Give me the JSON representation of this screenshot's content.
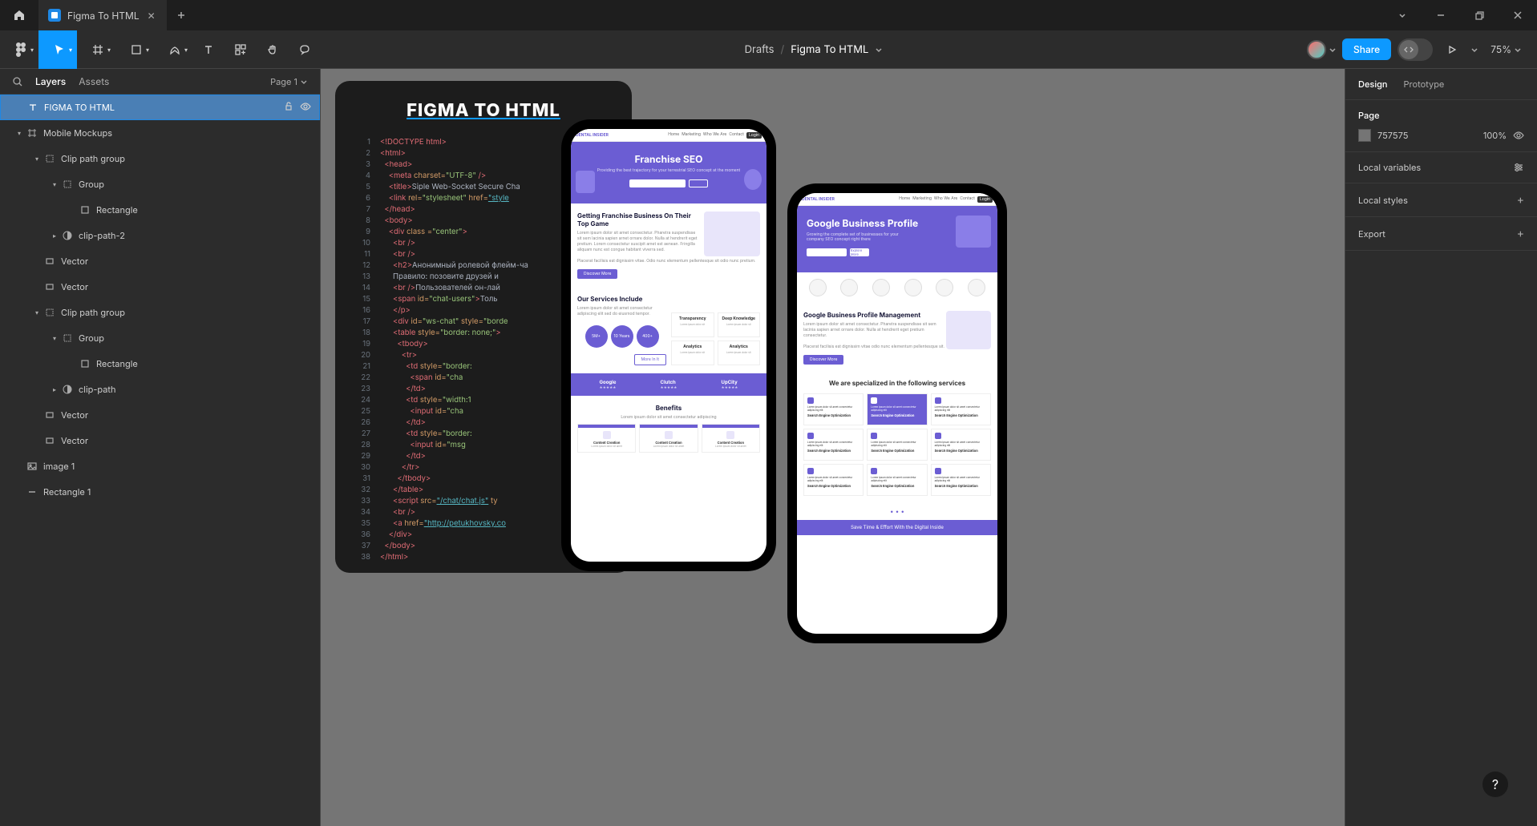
{
  "titlebar": {
    "tab_name": "Figma To HTML"
  },
  "toolbar": {
    "breadcrumb_root": "Drafts",
    "breadcrumb_current": "Figma To HTML",
    "share_label": "Share",
    "zoom_label": "75%"
  },
  "left_panel": {
    "tab_layers": "Layers",
    "tab_assets": "Assets",
    "page_label": "Page 1",
    "layers": [
      {
        "name": "FIGMA TO HTML",
        "type": "text",
        "depth": 0,
        "selected": true,
        "actions": true
      },
      {
        "name": "Mobile Mockups",
        "type": "frame",
        "depth": 0,
        "expanded": true
      },
      {
        "name": "Clip path group",
        "type": "group",
        "depth": 1,
        "expanded": true
      },
      {
        "name": "Group",
        "type": "group",
        "depth": 2,
        "expanded": true
      },
      {
        "name": "Rectangle",
        "type": "rect",
        "depth": 3
      },
      {
        "name": "clip-path-2",
        "type": "mask",
        "depth": 2,
        "collapsed": true
      },
      {
        "name": "Vector",
        "type": "vector",
        "depth": 1
      },
      {
        "name": "Vector",
        "type": "vector",
        "depth": 1
      },
      {
        "name": "Clip path group",
        "type": "group",
        "depth": 1,
        "expanded": true
      },
      {
        "name": "Group",
        "type": "group",
        "depth": 2,
        "expanded": true
      },
      {
        "name": "Rectangle",
        "type": "rect",
        "depth": 3
      },
      {
        "name": "clip-path",
        "type": "mask",
        "depth": 2,
        "collapsed": true
      },
      {
        "name": "Vector",
        "type": "vector",
        "depth": 1
      },
      {
        "name": "Vector",
        "type": "vector",
        "depth": 1
      },
      {
        "name": "image 1",
        "type": "image",
        "depth": 0
      },
      {
        "name": "Rectangle 1",
        "type": "line",
        "depth": 0
      }
    ]
  },
  "right_panel": {
    "tab_design": "Design",
    "tab_prototype": "Prototype",
    "page_section": "Page",
    "page_color": "757575",
    "page_opacity": "100%",
    "local_variables": "Local variables",
    "local_styles": "Local styles",
    "export": "Export"
  },
  "canvas": {
    "code_title": "FIGMA TO HTML",
    "code_lines": [
      {
        "n": 1,
        "html": "<span class='c-tag'>&lt;!DOCTYPE html&gt;</span>"
      },
      {
        "n": 2,
        "html": "<span class='c-tag'>&lt;html&gt;</span>"
      },
      {
        "n": 3,
        "html": "  <span class='c-tag'>&lt;head&gt;</span>"
      },
      {
        "n": 4,
        "html": "    <span class='c-tag'>&lt;meta</span> <span class='c-attr'>charset=</span><span class='c-str'>\"UTF-8\"</span> <span class='c-tag'>/&gt;</span>"
      },
      {
        "n": 5,
        "html": "    <span class='c-tag'>&lt;title&gt;</span><span class='c-text'>Siple Web-Socket Secure Cha</span>"
      },
      {
        "n": 6,
        "html": "    <span class='c-tag'>&lt;link</span> <span class='c-attr'>rel=</span><span class='c-str'>\"stylesheet\"</span> <span class='c-attr'>href=</span><span class='c-link'>\"style</span>"
      },
      {
        "n": 7,
        "html": "  <span class='c-tag'>&lt;/head&gt;</span>"
      },
      {
        "n": 8,
        "html": "  <span class='c-tag'>&lt;body&gt;</span>"
      },
      {
        "n": 9,
        "html": "    <span class='c-tag'>&lt;div</span> <span class='c-attr'>class =</span><span class='c-str'>\"center\"</span><span class='c-tag'>&gt;</span>"
      },
      {
        "n": 10,
        "html": "      <span class='c-tag'>&lt;br /&gt;</span>"
      },
      {
        "n": 11,
        "html": "      <span class='c-tag'>&lt;br /&gt;</span>"
      },
      {
        "n": 12,
        "html": "      <span class='c-tag'>&lt;h2&gt;</span><span class='c-text'>Анонимный ролевой флейм-ча</span>"
      },
      {
        "n": 13,
        "html": "      <span class='c-text'>Правило: позовите друзей и </span>"
      },
      {
        "n": 14,
        "html": "      <span class='c-tag'>&lt;br /&gt;</span><span class='c-text'>Пользователей он-лай</span>"
      },
      {
        "n": 15,
        "html": "      <span class='c-tag'>&lt;span</span> <span class='c-attr'>id=</span><span class='c-str'>\"chat-users\"</span><span class='c-tag'>&gt;</span><span class='c-text'>Толь</span>"
      },
      {
        "n": 16,
        "html": "      <span class='c-tag'>&lt;/p&gt;</span>"
      },
      {
        "n": 17,
        "html": "      <span class='c-tag'>&lt;div</span> <span class='c-attr'>id=</span><span class='c-str'>\"ws-chat\"</span> <span class='c-attr'>style=</span><span class='c-str'>\"borde</span>"
      },
      {
        "n": 18,
        "html": "      <span class='c-tag'>&lt;table</span> <span class='c-attr'>style=</span><span class='c-str'>\"border: none;\"</span><span class='c-tag'>&gt;</span>"
      },
      {
        "n": 19,
        "html": "        <span class='c-tag'>&lt;tbody&gt;</span>"
      },
      {
        "n": 20,
        "html": "          <span class='c-tag'>&lt;tr&gt;</span>"
      },
      {
        "n": 21,
        "html": "            <span class='c-tag'>&lt;td</span> <span class='c-attr'>style=</span><span class='c-str'>\"border:</span>"
      },
      {
        "n": 22,
        "html": "              <span class='c-tag'>&lt;span</span> <span class='c-attr'>id=</span><span class='c-str'>\"cha</span>"
      },
      {
        "n": 23,
        "html": "            <span class='c-tag'>&lt;/td&gt;</span>"
      },
      {
        "n": 24,
        "html": "            <span class='c-tag'>&lt;td</span> <span class='c-attr'>style=</span><span class='c-str'>\"width:1</span>"
      },
      {
        "n": 25,
        "html": "              <span class='c-tag'>&lt;input</span> <span class='c-attr'>id=</span><span class='c-str'>\"cha</span>"
      },
      {
        "n": 26,
        "html": "            <span class='c-tag'>&lt;/td&gt;</span>"
      },
      {
        "n": 27,
        "html": "            <span class='c-tag'>&lt;td</span> <span class='c-attr'>style=</span><span class='c-str'>\"border:</span>"
      },
      {
        "n": 28,
        "html": "              <span class='c-tag'>&lt;input</span> <span class='c-attr'>id=</span><span class='c-str'>\"msg</span>"
      },
      {
        "n": 29,
        "html": "            <span class='c-tag'>&lt;/td&gt;</span>"
      },
      {
        "n": 30,
        "html": "          <span class='c-tag'>&lt;/tr&gt;</span>"
      },
      {
        "n": 31,
        "html": "        <span class='c-tag'>&lt;/tbody&gt;</span>"
      },
      {
        "n": 32,
        "html": "      <span class='c-tag'>&lt;/table&gt;</span>"
      },
      {
        "n": 33,
        "html": "      <span class='c-tag'>&lt;script</span> <span class='c-attr'>src=</span><span class='c-link'>\"/chat/chat.js\"</span> <span class='c-attr'>ty</span>"
      },
      {
        "n": 34,
        "html": "      <span class='c-tag'>&lt;br /&gt;</span>"
      },
      {
        "n": 35,
        "html": "      <span class='c-tag'>&lt;a</span> <span class='c-attr'>href=</span><span class='c-link'>\"http://petukhovsky.co</span>"
      },
      {
        "n": 36,
        "html": "    <span class='c-tag'>&lt;/div&gt;</span>"
      },
      {
        "n": 37,
        "html": "  <span class='c-tag'>&lt;/body&gt;</span>"
      },
      {
        "n": 38,
        "html": "<span class='c-tag'>&lt;/html&gt;</span>"
      }
    ],
    "phone1": {
      "logo": "DENTAL INSIDER",
      "hero_title": "Franchise SEO",
      "hero_sub": "Providing the best trajectory for your terrestrial SEO concept at the moment",
      "section1_title": "Getting Franchise Business On Their Top Game",
      "section1_cta": "Discover More",
      "services_title": "Our Services Include",
      "services": [
        "Transparency",
        "Deep Knowledge",
        "Analytics",
        "Analytics"
      ],
      "circles": [
        "5M+",
        "10 Years",
        "400+"
      ],
      "btn_more": "More In It",
      "banner": [
        "Google",
        "Clutch",
        "UpCity"
      ],
      "benefits_title": "Benefits",
      "benefit_cards": [
        "Content Creation",
        "Content Creation",
        "Content Creation"
      ]
    },
    "phone2": {
      "logo": "DENTAL INSIDER",
      "hero_title": "Google Business Profile",
      "hero_sub": "Growing the complete set of businesses for your company SEO concept right there",
      "hero_btn": "Explore More",
      "gbp_title": "Google Business Profile Management",
      "gbp_cta": "Discover More",
      "spec_title": "We are specialized in the following services",
      "spec_cards_count": 9,
      "footer": "Save Time & Effort With the Digital Inside"
    }
  },
  "help": "?"
}
